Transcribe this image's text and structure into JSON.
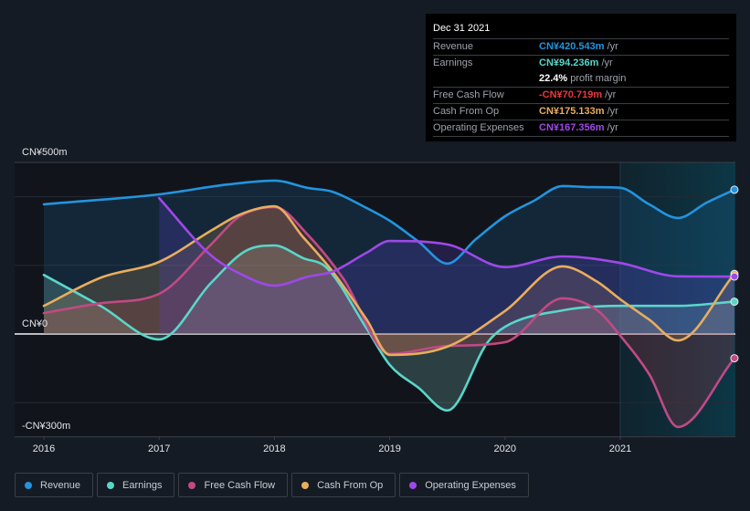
{
  "tooltip": {
    "date": "Dec 31 2021",
    "rows": [
      {
        "label": "Revenue",
        "value": "CN¥420.543m",
        "unit": "/yr",
        "color": "#2394df"
      },
      {
        "label": "Earnings",
        "value": "CN¥94.236m",
        "unit": "/yr",
        "color": "#5ad6c9"
      },
      {
        "label": "",
        "value": "22.4%",
        "unit": "profit margin",
        "color": "#ffffff"
      },
      {
        "label": "Free Cash Flow",
        "value": "-CN¥70.719m",
        "unit": "/yr",
        "color": "#e8393e"
      },
      {
        "label": "Cash From Op",
        "value": "CN¥175.133m",
        "unit": "/yr",
        "color": "#e8ad5e"
      },
      {
        "label": "Operating Expenses",
        "value": "CN¥167.356m",
        "unit": "/yr",
        "color": "#9f48e8"
      }
    ]
  },
  "legend": [
    {
      "label": "Revenue",
      "color": "#2394df"
    },
    {
      "label": "Earnings",
      "color": "#5ad6c9"
    },
    {
      "label": "Free Cash Flow",
      "color": "#c04a84"
    },
    {
      "label": "Cash From Op",
      "color": "#e8ad5e"
    },
    {
      "label": "Operating Expenses",
      "color": "#9f48e8"
    }
  ],
  "chart_data": {
    "type": "line",
    "title": "",
    "xlabel": "",
    "ylabel": "",
    "unit": "CN¥ millions",
    "y_tick_labels": [
      "CN¥500m",
      "CN¥0",
      "-CN¥300m"
    ],
    "y_ticks": [
      500,
      0,
      -300
    ],
    "ylim": [
      -300,
      500
    ],
    "xlim": [
      2015.75,
      2021.99
    ],
    "x_tick_labels": [
      "2016",
      "2017",
      "2018",
      "2019",
      "2020",
      "2021"
    ],
    "x_ticks": [
      2016,
      2017,
      2018,
      2019,
      2020,
      2021
    ],
    "highlight_from": 2021.0,
    "grid": true,
    "legend_position": "bottom",
    "series": [
      {
        "name": "Revenue",
        "color": "#2394df",
        "x": [
          2016.0,
          2017.0,
          2017.6,
          2018.0,
          2018.3,
          2018.5,
          2018.8,
          2019.0,
          2019.25,
          2019.5,
          2019.75,
          2020.0,
          2020.25,
          2020.5,
          2020.75,
          2021.0,
          2021.25,
          2021.5,
          2021.75,
          2021.99
        ],
        "values": [
          378,
          407,
          436,
          447,
          425,
          415,
          367,
          330,
          269,
          205,
          277,
          343,
          388,
          431,
          428,
          426,
          378,
          338,
          383,
          420.5
        ]
      },
      {
        "name": "Earnings",
        "color": "#5ad6c9",
        "x": [
          2016.0,
          2016.5,
          2017.0,
          2017.45,
          2017.75,
          2018.0,
          2018.25,
          2018.45,
          2018.8,
          2019.0,
          2019.25,
          2019.5,
          2019.85,
          2020.0,
          2020.5,
          2021.0,
          2021.5,
          2021.99
        ],
        "values": [
          172,
          80,
          -16,
          149,
          242,
          258,
          221,
          194,
          16,
          -90,
          -157,
          -223,
          -24,
          21,
          69,
          82,
          82,
          94.2
        ]
      },
      {
        "name": "Free Cash Flow",
        "color": "#c04a84",
        "x": [
          2016.0,
          2016.5,
          2017.0,
          2017.45,
          2017.7,
          2018.0,
          2018.3,
          2018.6,
          2019.0,
          2019.5,
          2020.0,
          2020.5,
          2020.8,
          2021.0,
          2021.25,
          2021.5,
          2021.99
        ],
        "values": [
          61,
          90,
          117,
          261,
          343,
          370,
          285,
          160,
          -58,
          -35,
          -24,
          104,
          69,
          -5,
          -117,
          -271,
          -70.7
        ]
      },
      {
        "name": "Cash From Op",
        "color": "#e8ad5e",
        "x": [
          2016.0,
          2016.5,
          2017.0,
          2017.45,
          2017.7,
          2018.0,
          2018.25,
          2018.5,
          2018.8,
          2019.0,
          2019.5,
          2020.0,
          2020.5,
          2020.8,
          2021.0,
          2021.25,
          2021.5,
          2021.99
        ],
        "values": [
          82,
          165,
          210,
          301,
          348,
          372,
          282,
          184,
          42,
          -61,
          -37,
          67,
          197,
          152,
          101,
          42,
          -19,
          175.1
        ]
      },
      {
        "name": "Operating Expenses",
        "color": "#9f48e8",
        "x": [
          2017.0,
          2017.45,
          2017.7,
          2018.0,
          2018.3,
          2018.5,
          2018.8,
          2019.0,
          2019.5,
          2020.0,
          2020.5,
          2021.0,
          2021.5,
          2021.99
        ],
        "values": [
          396,
          229,
          176,
          141,
          168,
          181,
          237,
          271,
          261,
          195,
          226,
          207,
          168,
          167.4
        ]
      }
    ]
  }
}
